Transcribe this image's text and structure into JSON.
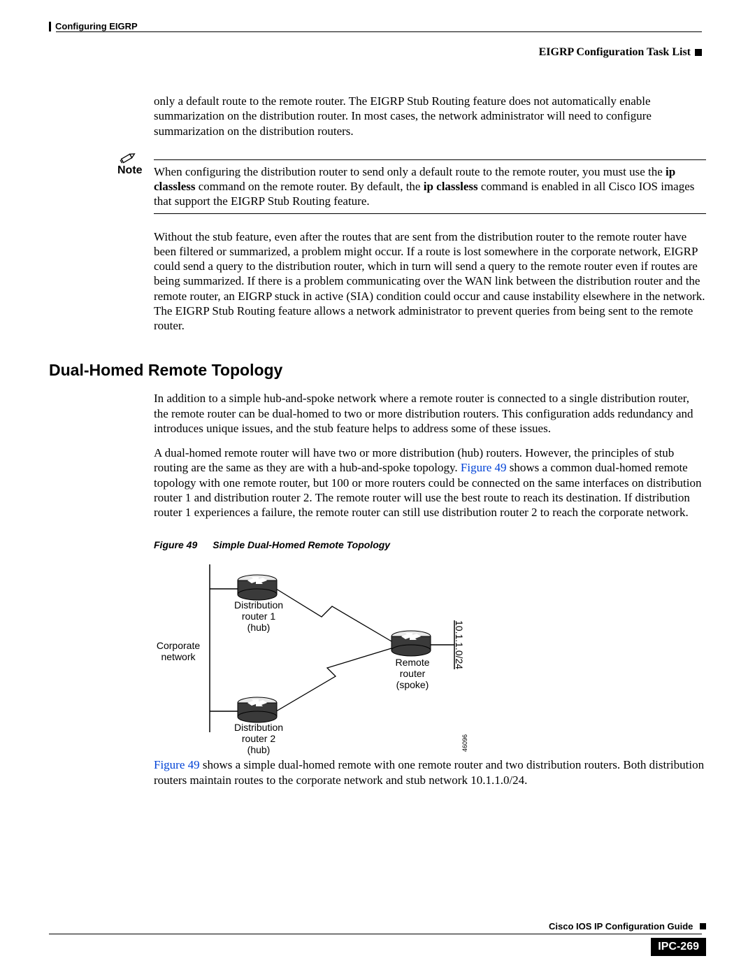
{
  "header": {
    "chapter": "Configuring EIGRP",
    "section": "EIGRP Configuration Task List"
  },
  "body": {
    "p1": "only a default route to the remote router. The EIGRP Stub Routing feature does not automatically enable summarization on the distribution router. In most cases, the network administrator will need to configure summarization on the distribution routers.",
    "note_label": "Note",
    "note_text_1": "When configuring the distribution router to send only a default route to the remote router, you must use the ",
    "note_cmd1": "ip classless",
    "note_text_2": " command on the remote router. By default, the ",
    "note_cmd2": "ip classless",
    "note_text_3": " command is enabled in all Cisco IOS images that support the EIGRP Stub Routing feature.",
    "p2": "Without the stub feature, even after the routes that are sent from the distribution router to the remote router have been filtered or summarized, a problem might occur. If a route is lost somewhere in the corporate network, EIGRP could send a query to the distribution router, which in turn will send a query to the remote router even if routes are being summarized. If there is a problem communicating over the WAN link between the distribution router and the remote router, an EIGRP stuck in active (SIA) condition could occur and cause instability elsewhere in the network. The EIGRP Stub Routing feature allows a network administrator to prevent queries from being sent to the remote router.",
    "h1": "Dual-Homed Remote Topology",
    "p3": "In addition to a simple hub-and-spoke network where a remote router is connected to a single distribution router, the remote router can be dual-homed to two or more distribution routers. This configuration adds redundancy and introduces unique issues, and the stub feature helps to address some of these issues.",
    "p4_a": "A dual-homed remote router will have two or more distribution (hub) routers. However, the principles of stub routing are the same as they are with a hub-and-spoke topology. ",
    "p4_link": "Figure 49",
    "p4_b": " shows a common dual-homed remote topology with one remote router, but 100 or more routers could be connected on the same interfaces on distribution router 1 and distribution router 2. The remote router will use the best route to reach its destination. If distribution router 1 experiences a failure, the remote router can still use distribution router 2 to reach the corporate network.",
    "fig_num": "Figure 49",
    "fig_title": "Simple Dual-Homed Remote Topology",
    "diagram": {
      "corp": "Corporate\nnetwork",
      "dist1": "Distribution\nrouter 1\n(hub)",
      "dist2": "Distribution\nrouter 2\n(hub)",
      "remote": "Remote\nrouter\n(spoke)",
      "subnet": "10.1.1.0/24",
      "figid": "46096"
    },
    "p5_link": "Figure 49",
    "p5": " shows a simple dual-homed remote with one remote router and two distribution routers. Both distribution routers maintain routes to the corporate network and stub network 10.1.1.0/24."
  },
  "footer": {
    "guide": "Cisco IOS IP Configuration Guide",
    "page": "IPC-269"
  }
}
